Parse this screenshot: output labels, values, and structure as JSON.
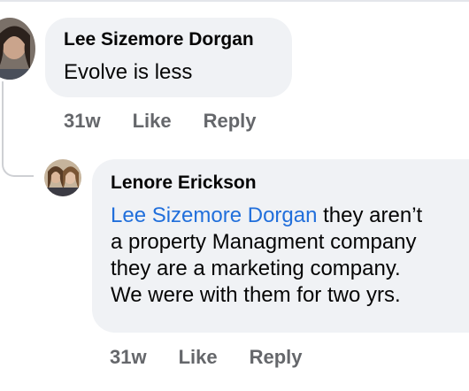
{
  "comments": [
    {
      "author": "Lee Sizemore Dorgan",
      "text": "Evolve is less",
      "time": "31w",
      "like_label": "Like",
      "reply_label": "Reply"
    }
  ],
  "reply": {
    "author": "Lenore Erickson",
    "mention": "Lee Sizemore Dorgan",
    "line1_rest": " they aren’t",
    "line2": "a property Managment company",
    "line3": "they are a marketing company.",
    "line4": "We were with them for two yrs.",
    "time": "31w",
    "like_label": "Like",
    "reply_label": "Reply"
  },
  "colors": {
    "bubble": "#f0f2f5",
    "mention": "#216fdb",
    "meta": "#65676b",
    "text": "#050505"
  }
}
